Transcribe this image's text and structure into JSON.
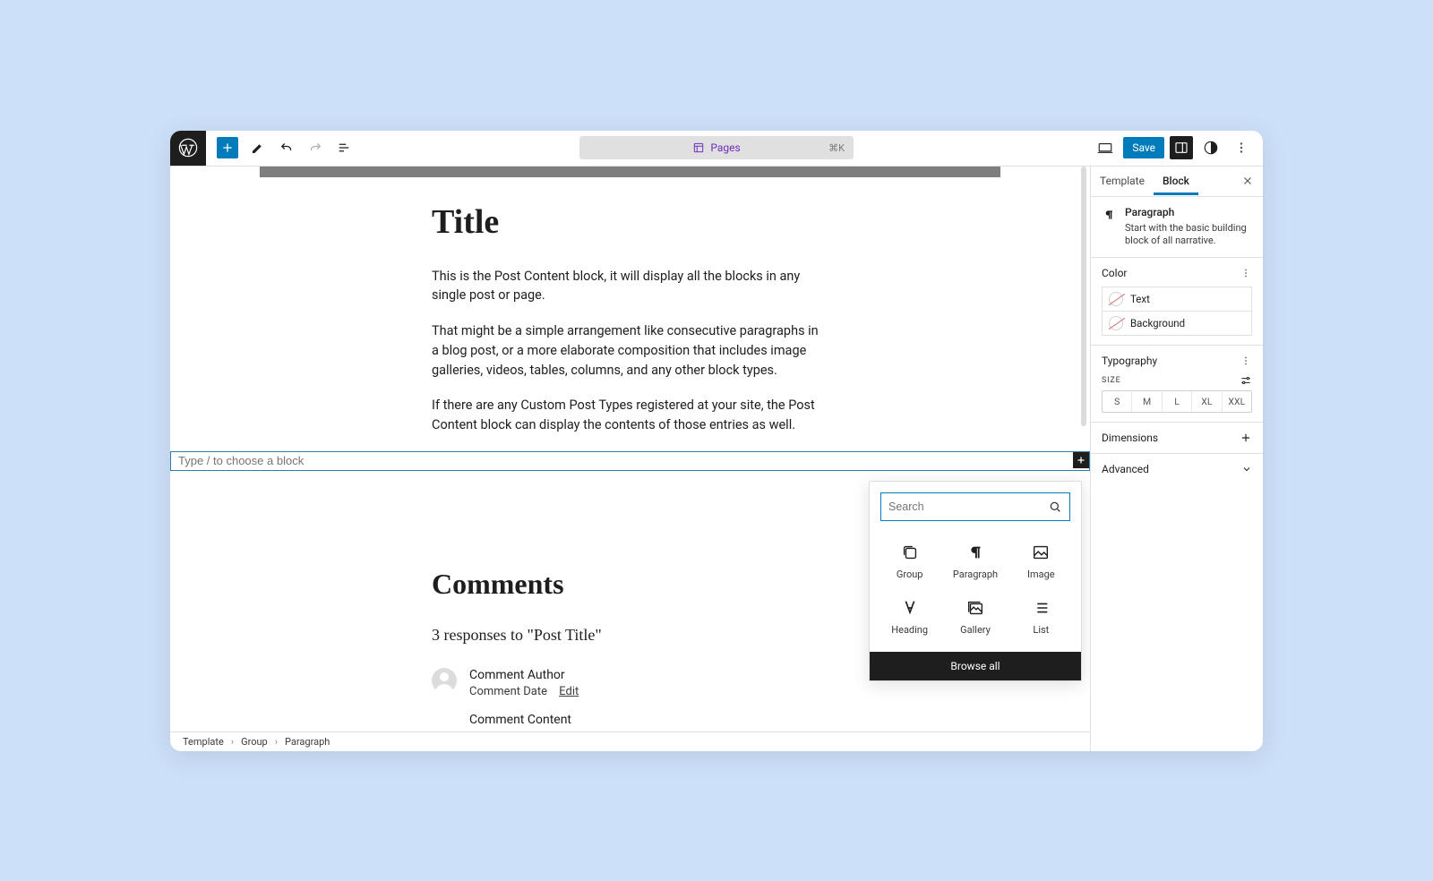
{
  "toolbar": {
    "doc_name": "Pages",
    "shortcut": "⌘K",
    "save_label": "Save"
  },
  "content": {
    "title": "Title",
    "p1": "This is the Post Content block, it will display all the blocks in any single post or page.",
    "p2": "That might be a simple arrangement like consecutive paragraphs in a blog post, or a more elaborate composition that includes image galleries, videos, tables, columns, and any other block types.",
    "p3": "If there are any Custom Post Types registered at your site, the Post Content block can display the contents of those entries as well.",
    "new_block_placeholder": "Type / to choose a block"
  },
  "comments": {
    "heading": "Comments",
    "responses": "3 responses to \"Post Title\"",
    "author": "Comment Author",
    "date": "Comment Date",
    "edit": "Edit",
    "content": "Comment Content"
  },
  "inserter": {
    "search_placeholder": "Search",
    "items": [
      "Group",
      "Paragraph",
      "Image",
      "Heading",
      "Gallery",
      "List"
    ],
    "browse": "Browse all"
  },
  "sidebar": {
    "tab_template": "Template",
    "tab_block": "Block",
    "block_name": "Paragraph",
    "block_desc": "Start with the basic building block of all narrative.",
    "color_heading": "Color",
    "color_text": "Text",
    "color_bg": "Background",
    "typography_heading": "Typography",
    "size_label": "SIZE",
    "sizes": [
      "S",
      "M",
      "L",
      "XL",
      "XXL"
    ],
    "dimensions": "Dimensions",
    "advanced": "Advanced"
  },
  "breadcrumb": {
    "items": [
      "Template",
      "Group",
      "Paragraph"
    ]
  }
}
